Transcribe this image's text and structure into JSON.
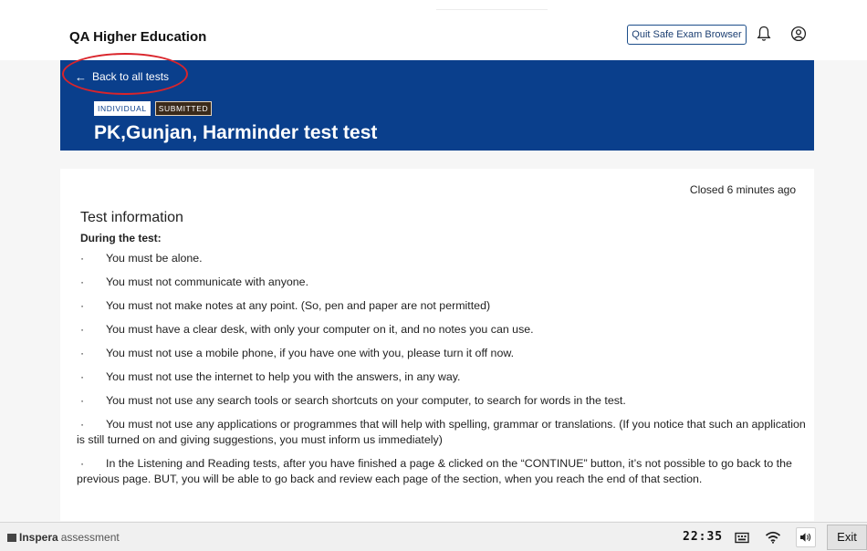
{
  "header": {
    "app_title": "QA Higher Education",
    "quit_button": "Quit Safe Exam Browser",
    "icons": [
      "bell-icon",
      "user-circle-icon"
    ]
  },
  "hero": {
    "back_link": "Back to all tests",
    "back_icon": "arrow-left-icon",
    "badges": [
      "INDIVIDUAL",
      "SUBMITTED"
    ],
    "test_name": "PK,Gunjan, Harminder test test",
    "background": "#0a3f8c"
  },
  "card": {
    "status": "Closed 6 minutes ago",
    "section_title": "Test information",
    "subheading": "During the test:",
    "bullet": "·",
    "rules": [
      "You must be alone.",
      "You must not communicate with anyone.",
      "You must not make notes at any point. (So, pen and paper are not permitted)",
      "You must have a clear desk, with only your computer on it, and no notes you can use.",
      "You must not use a mobile phone, if you have one with you, please turn it off now.",
      "You must not use the internet to help you with the answers, in any way.",
      "You must not use any search tools or search shortcuts on your computer, to search for words in the test.",
      "You must not use any applications or programmes that will help with spelling, grammar or translations. (If you notice that such an application is still turned on and giving suggestions, you must inform us immediately)",
      "In the Listening and Reading tests, after you have finished a page & clicked on the “CONTINUE” button, it’s not possible to go back to the previous page. BUT, you will be able to go back and review each page of the section, when you reach the end of that section."
    ]
  },
  "taskbar": {
    "brand_bold": "Inspera",
    "brand_rest": " assessment",
    "clock": "22:35",
    "exit_button": "Exit",
    "tray_icons": [
      "keyboard-layout-icon",
      "wifi-icon",
      "volume-icon"
    ]
  },
  "colors": {
    "accent": "#0a3f8c",
    "annotation": "#d9242b"
  }
}
